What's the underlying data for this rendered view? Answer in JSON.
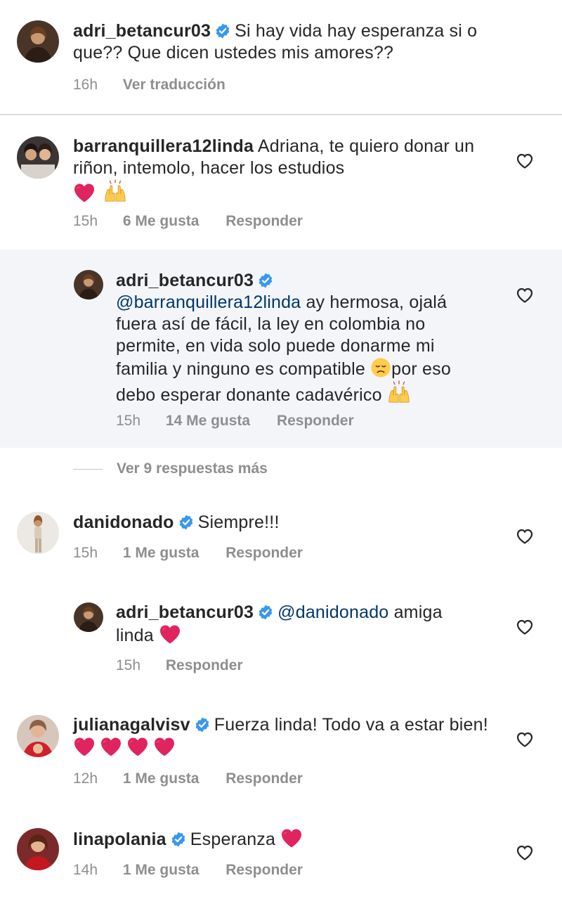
{
  "colors": {
    "username": "#262626",
    "mention": "#00376b",
    "meta": "#8e8e8e",
    "verified": "#3897f0",
    "reply_bg": "#f3f5f9",
    "divider": "#dbdbdb",
    "heart_emoji": "#e0245e"
  },
  "post": {
    "username": "adri_betancur03",
    "text": "Si hay vida hay esperanza si o que?? Que dicen ustedes mis amores??",
    "time": "16h",
    "translate": "Ver traducción"
  },
  "comments": [
    {
      "username": "barranquillera12linda",
      "text": "Adriana,  te quiero donar un riñon, intemolo, hacer los  estudios",
      "time": "15h",
      "likes": "6 Me gusta",
      "reply": "Responder"
    },
    {
      "username": "adri_betancur03",
      "mention": "@barranquillera12linda",
      "text": "ay hermosa, ojalá fuera así de fácil, la ley en colombia no permite, en vida solo puede donarme mi familia y ninguno es compatible",
      "text2": "por eso debo esperar donante cadavérico",
      "time": "15h",
      "likes": "14 Me gusta",
      "reply": "Responder"
    },
    {
      "view_more": "Ver 9 respuestas más"
    },
    {
      "username": "danidonado",
      "text": "Siempre!!!",
      "time": "15h",
      "likes": "1 Me gusta",
      "reply": "Responder"
    },
    {
      "username": "adri_betancur03",
      "mention": "@danidonado",
      "text": "amiga linda",
      "time": "15h",
      "reply": "Responder"
    },
    {
      "username": "julianagalvisv",
      "text": "Fuerza linda! Todo va a estar bien!",
      "time": "12h",
      "likes": "1 Me gusta",
      "reply": "Responder"
    },
    {
      "username": "linapolania",
      "text": "Esperanza",
      "time": "14h",
      "likes": "1 Me gusta",
      "reply": "Responder"
    }
  ],
  "icons": [
    "verified-badge-icon",
    "heart-outline-icon",
    "red-heart-emoji",
    "raising-hands-emoji",
    "disappointed-face-emoji"
  ]
}
